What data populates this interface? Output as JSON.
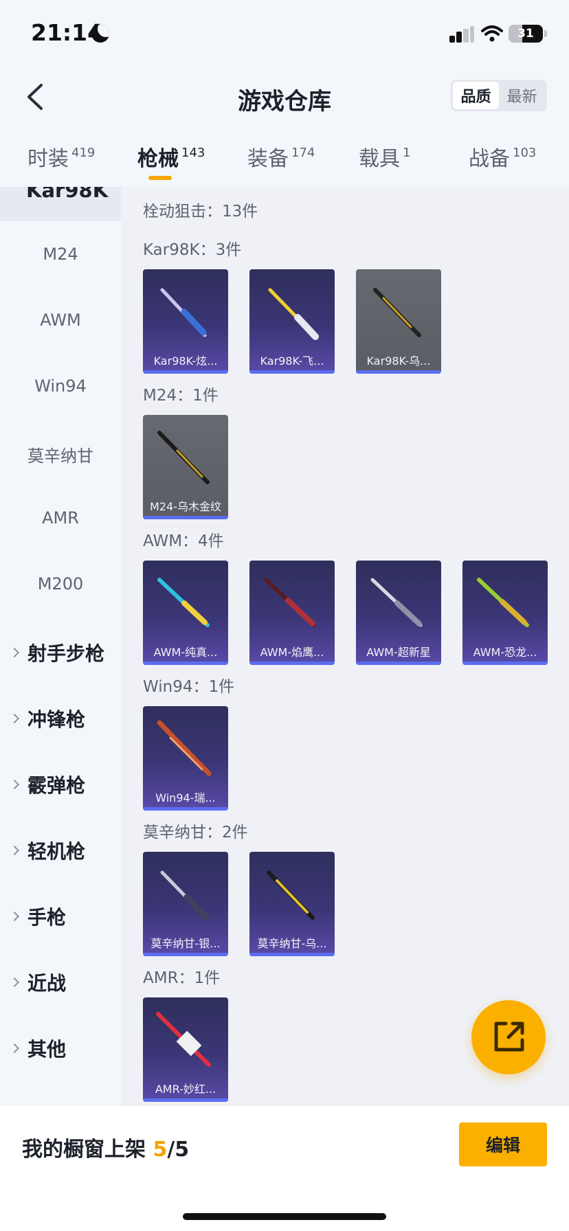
{
  "status": {
    "time": "21:14",
    "battery": "31"
  },
  "header": {
    "title": "游戏仓库",
    "sort_options": [
      "品质",
      "最新"
    ]
  },
  "tabs": [
    {
      "label": "时装",
      "count": "419"
    },
    {
      "label": "枪械",
      "count": "143"
    },
    {
      "label": "装备",
      "count": "174"
    },
    {
      "label": "载具",
      "count": "1"
    },
    {
      "label": "战备",
      "count": "103"
    }
  ],
  "sidebar": {
    "active_item": "Kar98K",
    "sub_items": [
      "M24",
      "AWM",
      "Win94",
      "莫辛纳甘",
      "AMR",
      "M200"
    ],
    "groups": [
      "射手步枪",
      "冲锋枪",
      "霰弹枪",
      "轻机枪",
      "手枪",
      "近战",
      "其他"
    ]
  },
  "content": {
    "category_header": "栓动狙击：13件",
    "sections": [
      {
        "title": "Kar98K：3件",
        "items": [
          {
            "label": "Kar98K-炫...",
            "rarity": "purple"
          },
          {
            "label": "Kar98K-飞...",
            "rarity": "purple"
          },
          {
            "label": "Kar98K-乌...",
            "rarity": "gray"
          }
        ]
      },
      {
        "title": "M24：1件",
        "items": [
          {
            "label": "M24-乌木金纹",
            "rarity": "gray"
          }
        ]
      },
      {
        "title": "AWM：4件",
        "items": [
          {
            "label": "AWM-纯真...",
            "rarity": "purple"
          },
          {
            "label": "AWM-焰鹰...",
            "rarity": "purple"
          },
          {
            "label": "AWM-超新星",
            "rarity": "purple"
          },
          {
            "label": "AWM-恐龙...",
            "rarity": "purple"
          }
        ]
      },
      {
        "title": "Win94：1件",
        "items": [
          {
            "label": "Win94-瑞...",
            "rarity": "purple"
          }
        ]
      },
      {
        "title": "莫辛纳甘：2件",
        "items": [
          {
            "label": "莫辛纳甘-银...",
            "rarity": "purple"
          },
          {
            "label": "莫辛纳甘-乌...",
            "rarity": "purple"
          }
        ]
      },
      {
        "title": "AMR：1件",
        "items": [
          {
            "label": "AMR-妙红...",
            "rarity": "purple"
          }
        ]
      }
    ]
  },
  "bottom": {
    "shelf_label": "我的橱窗上架",
    "shelf_current": "5",
    "shelf_total": "/5",
    "edit_label": "编辑"
  },
  "colors": {
    "accent": "#fbb000",
    "rare_purple": "#3b3676",
    "common_gray": "#5b5d64",
    "rarity_strip": "#5b6df0"
  },
  "icons": [
    "back-arrow-icon",
    "share-export-icon",
    "chevron-right-icon",
    "moon-icon",
    "signal-icon",
    "wifi-icon",
    "battery-icon"
  ]
}
